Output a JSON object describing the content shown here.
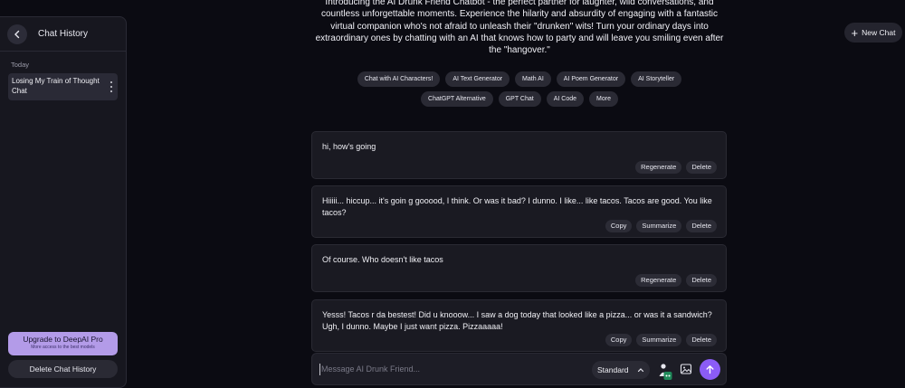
{
  "sidebar": {
    "title": "Chat History",
    "section_label": "Today",
    "history_items": [
      {
        "label": "Losing My Train of Thought Chat"
      }
    ],
    "upgrade_title": "Upgrade to DeepAI Pro",
    "upgrade_subtitle": "More access to the best models",
    "delete_history_label": "Delete Chat History"
  },
  "header": {
    "intro_text": "Introducing the AI Drunk Friend Chatbot - the perfect partner for laughter, wild conversations, and countless unforgettable moments. Experience the hilarity and absurdity of engaging with a fantastic virtual companion who's not afraid to unleash their \"drunken\" wits! Turn your ordinary days into extraordinary ones by chatting with an AI that knows how to party and will leave you smiling even after the \"hangover.\"",
    "new_chat_label": "New Chat"
  },
  "tags": {
    "row1": [
      "Chat with AI Characters!",
      "AI Text Generator",
      "Math AI",
      "AI Poem Generator",
      "AI Storyteller"
    ],
    "row2": [
      "ChatGPT Alternative",
      "GPT Chat",
      "AI Code",
      "More"
    ]
  },
  "messages": [
    {
      "role": "user",
      "text": "hi, how's going",
      "actions": [
        "Regenerate",
        "Delete"
      ]
    },
    {
      "role": "bot",
      "text": "Hiiiii... hiccup... it's goin g gooood, I think. Or was it bad? I dunno. I like... like tacos. Tacos are good. You like tacos?",
      "actions": [
        "Copy",
        "Summarize",
        "Delete"
      ]
    },
    {
      "role": "user",
      "text": "Of course. Who doesn't like tacos",
      "actions": [
        "Regenerate",
        "Delete"
      ]
    },
    {
      "role": "bot",
      "text": "Yesss! Tacos r da bestest! Did u knooow... I saw a dog today that looked like a pizza... or was it a sandwich? Ugh, I dunno. Maybe I just want pizza. Pizzaaaaa!",
      "actions": [
        "Copy",
        "Summarize",
        "Delete"
      ]
    }
  ],
  "composer": {
    "placeholder": "Message AI Drunk Friend...",
    "model_label": "Standard"
  },
  "colors": {
    "background": "#0b0b12",
    "panel": "#17171f",
    "accent": "#8b5cf6",
    "upgrade": "#b39be8"
  }
}
